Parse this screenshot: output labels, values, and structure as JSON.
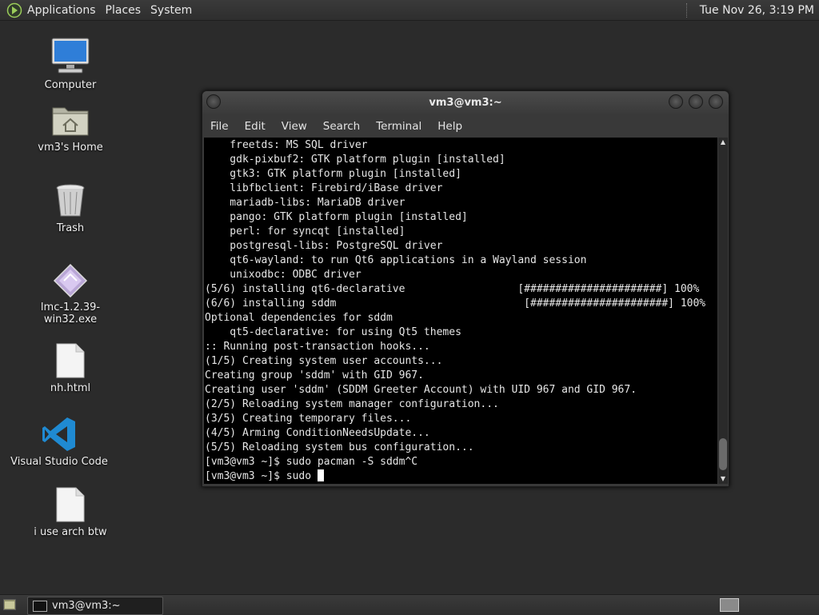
{
  "top_panel": {
    "menus": [
      "Applications",
      "Places",
      "System"
    ],
    "clock": "Tue Nov 26,  3:19 PM"
  },
  "desktop_icons": [
    {
      "label": "Computer",
      "icon": "computer-icon"
    },
    {
      "label": "vm3's Home",
      "icon": "home-folder-icon"
    },
    {
      "label": "Trash",
      "icon": "trash-icon"
    },
    {
      "label": "lmc-1.2.39-win32.exe",
      "icon": "executable-icon"
    },
    {
      "label": "nh.html",
      "icon": "file-icon"
    },
    {
      "label": "Visual Studio Code",
      "icon": "vscode-icon"
    },
    {
      "label": "i use arch btw",
      "icon": "file-icon"
    }
  ],
  "terminal": {
    "title": "vm3@vm3:~",
    "menu": [
      "File",
      "Edit",
      "View",
      "Search",
      "Terminal",
      "Help"
    ],
    "lines": [
      "    freetds: MS SQL driver",
      "    gdk-pixbuf2: GTK platform plugin [installed]",
      "    gtk3: GTK platform plugin [installed]",
      "    libfbclient: Firebird/iBase driver",
      "    mariadb-libs: MariaDB driver",
      "    pango: GTK platform plugin [installed]",
      "    perl: for syncqt [installed]",
      "    postgresql-libs: PostgreSQL driver",
      "    qt6-wayland: to run Qt6 applications in a Wayland session",
      "    unixodbc: ODBC driver",
      "(5/6) installing qt6-declarative                  [######################] 100%",
      "(6/6) installing sddm                              [######################] 100%",
      "Optional dependencies for sddm",
      "    qt5-declarative: for using Qt5 themes",
      ":: Running post-transaction hooks...",
      "(1/5) Creating system user accounts...",
      "Creating group 'sddm' with GID 967.",
      "Creating user 'sddm' (SDDM Greeter Account) with UID 967 and GID 967.",
      "(2/5) Reloading system manager configuration...",
      "(3/5) Creating temporary files...",
      "(4/5) Arming ConditionNeedsUpdate...",
      "(5/5) Reloading system bus configuration...",
      "[vm3@vm3 ~]$ sudo pacman -S sddm^C"
    ],
    "prompt_line": "[vm3@vm3 ~]$ sudo "
  },
  "bottom_panel": {
    "task_label": "vm3@vm3:~"
  }
}
